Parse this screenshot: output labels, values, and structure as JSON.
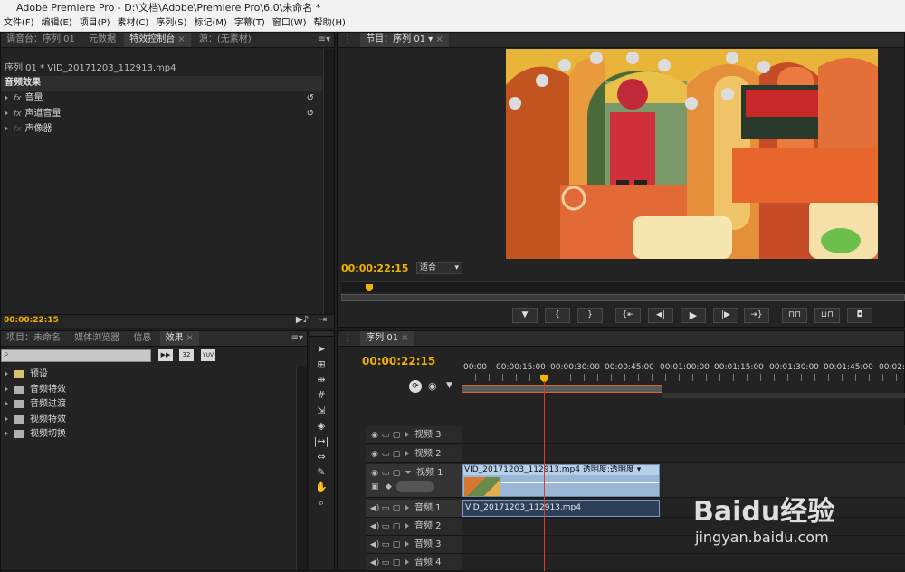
{
  "window": {
    "title": "Adobe Premiere Pro - D:\\文档\\Adobe\\Premiere Pro\\6.0\\未命名 *"
  },
  "menu": [
    "文件(F)",
    "编辑(E)",
    "项目(P)",
    "素材(C)",
    "序列(S)",
    "标记(M)",
    "字幕(T)",
    "窗口(W)",
    "帮助(H)"
  ],
  "top_left_tabs": [
    {
      "label": "调音台：序列 01"
    },
    {
      "label": "元数据"
    },
    {
      "label": "特效控制台"
    },
    {
      "label": "源：(无素材)"
    }
  ],
  "effect_controls": {
    "clip_path": "序列 01 * VID_20171203_112913.mp4",
    "section": "音频效果",
    "items": [
      "音量",
      "声道音量",
      "声像器"
    ],
    "timecode": "00:00:22:15"
  },
  "program_monitor": {
    "tab": "节目：序列 01",
    "timecode": "00:00:22:15",
    "zoom": "适合"
  },
  "bottom_left_tabs": [
    {
      "label": "项目：未命名"
    },
    {
      "label": "媒体浏览器"
    },
    {
      "label": "信息"
    },
    {
      "label": "效果"
    }
  ],
  "effects_browser": {
    "badges": [
      "32",
      "YUV"
    ],
    "folders": [
      "预设",
      "音频特效",
      "音频过渡",
      "视频特效",
      "视频切换"
    ]
  },
  "timeline": {
    "tab": "序列 01",
    "timecode": "00:00:22:15",
    "ruler": [
      "00:00",
      "00:00:15:00",
      "00:00:30:00",
      "00:00:45:00",
      "00:01:00:00",
      "00:01:15:00",
      "00:01:30:00",
      "00:01:45:00",
      "00:02:0"
    ],
    "video_tracks": [
      "视频 3",
      "视频 2",
      "视频 1"
    ],
    "audio_tracks": [
      "音频 1",
      "音频 2",
      "音频 3",
      "音频 4"
    ],
    "video_clip": {
      "name": "VID_20171203_112913.mp4",
      "effect": "透明度:透明度"
    },
    "audio_clip": {
      "name": "VID_20171203_112913.mp4"
    }
  },
  "watermark": {
    "brand": "Baidu经验",
    "url": "jingyan.baidu.com"
  }
}
